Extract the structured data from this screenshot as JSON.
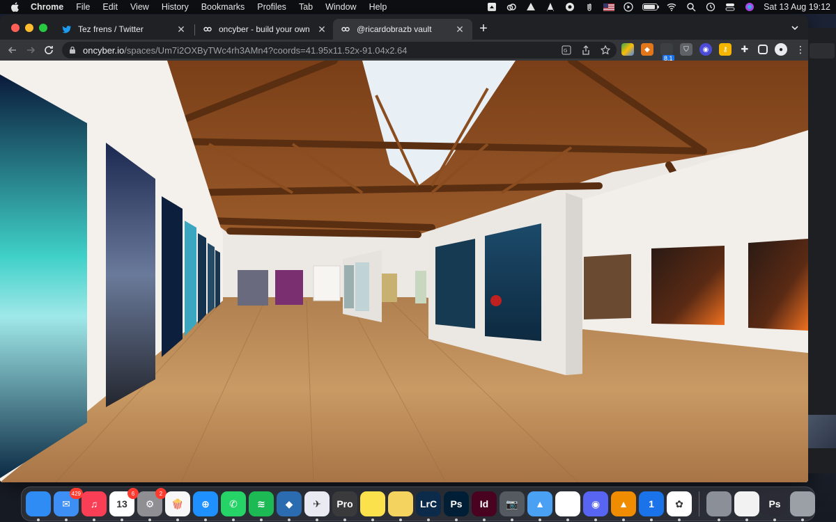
{
  "menubar": {
    "app_name": "Chrome",
    "menus": [
      "File",
      "Edit",
      "View",
      "History",
      "Bookmarks",
      "Profiles",
      "Tab",
      "Window",
      "Help"
    ],
    "clock": "Sat 13 Aug  19:12",
    "battery_level": 0.9
  },
  "browser": {
    "tabs": [
      {
        "title": "Tez frens / Twitter",
        "icon": "twitter-icon",
        "active": false
      },
      {
        "title": "oncyber - build your own world",
        "icon": "oncyber-icon",
        "active": false
      },
      {
        "title": "@ricardobrazb vault",
        "icon": "oncyber-icon",
        "active": true
      }
    ],
    "address": {
      "domain": "oncyber.io",
      "path": "/spaces/Um7i2OXByTWc4rh3AMn4?coords=41.95x11.52x-91.04x2.64"
    },
    "extension_badge": "8.1"
  },
  "dock": {
    "apps": [
      {
        "name": "finder",
        "label": "",
        "color": "#2f8cf5",
        "badge": ""
      },
      {
        "name": "mail",
        "label": "✉",
        "color": "#3d8ef5",
        "badge": "429"
      },
      {
        "name": "music",
        "label": "♫",
        "color": "#fa3e55",
        "badge": ""
      },
      {
        "name": "calendar",
        "label": "13",
        "color": "#ffffff",
        "badge": "6"
      },
      {
        "name": "system-preferences",
        "label": "⚙",
        "color": "#8e8e93",
        "badge": "2"
      },
      {
        "name": "popcorn",
        "label": "🍿",
        "color": "#f7f7f7",
        "badge": ""
      },
      {
        "name": "safari",
        "label": "⊕",
        "color": "#1e90ff",
        "badge": ""
      },
      {
        "name": "whatsapp",
        "label": "✆",
        "color": "#25d366",
        "badge": ""
      },
      {
        "name": "spotify",
        "label": "≋",
        "color": "#1db954",
        "badge": ""
      },
      {
        "name": "app-store-blue",
        "label": "◆",
        "color": "#2b6cb0",
        "badge": ""
      },
      {
        "name": "migration",
        "label": "✈",
        "color": "#eaeaf2",
        "badge": ""
      },
      {
        "name": "final-cut-pro",
        "label": "Pro",
        "color": "#3a3a3c",
        "badge": ""
      },
      {
        "name": "notes",
        "label": "",
        "color": "#fbe14c",
        "badge": ""
      },
      {
        "name": "stickies",
        "label": "",
        "color": "#f4d35e",
        "badge": ""
      },
      {
        "name": "lightroom",
        "label": "LrC",
        "color": "#0c2b4b",
        "badge": ""
      },
      {
        "name": "photoshop",
        "label": "Ps",
        "color": "#001e36",
        "badge": ""
      },
      {
        "name": "indesign",
        "label": "Id",
        "color": "#49021f",
        "badge": ""
      },
      {
        "name": "image-capture",
        "label": "📷",
        "color": "#555a60",
        "badge": ""
      },
      {
        "name": "keynote",
        "label": "▲",
        "color": "#4aa1f3",
        "badge": ""
      },
      {
        "name": "chrome",
        "label": "",
        "color": "#ffffff",
        "badge": ""
      },
      {
        "name": "discord",
        "label": "◉",
        "color": "#5865f2",
        "badge": ""
      },
      {
        "name": "vlc",
        "label": "▲",
        "color": "#f08c00",
        "badge": ""
      },
      {
        "name": "1password",
        "label": "1",
        "color": "#1a73e8",
        "badge": ""
      },
      {
        "name": "photos",
        "label": "✿",
        "color": "#ffffff",
        "badge": ""
      }
    ],
    "trailing": [
      {
        "name": "downloads-folder",
        "label": "",
        "color": "#8a8f98"
      },
      {
        "name": "recent-window",
        "label": "",
        "color": "#f2f2f2"
      },
      {
        "name": "photoshop-doc",
        "label": "Ps",
        "color": "#2b2b35"
      },
      {
        "name": "trash",
        "label": "",
        "color": "#9aa0a6"
      }
    ]
  }
}
